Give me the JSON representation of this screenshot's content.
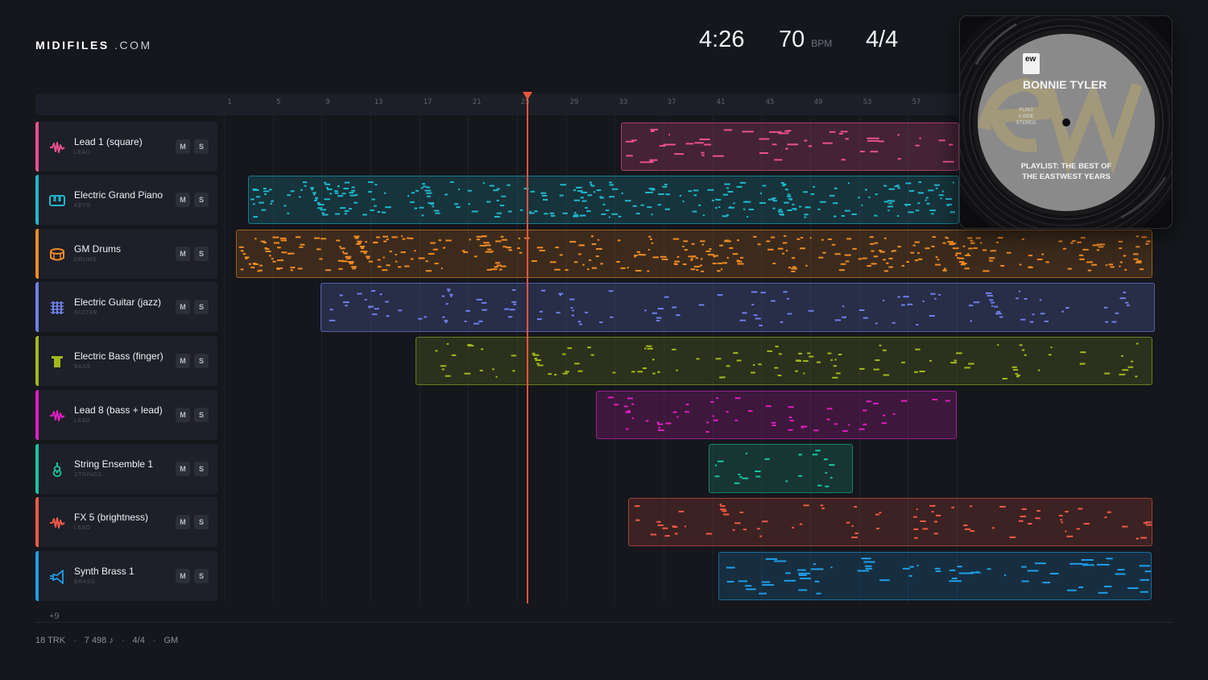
{
  "logo": {
    "brand": "MIDIFILES",
    "tld": ".COM"
  },
  "transport": {
    "time": "4:26",
    "tempo": "70",
    "tempo_unit": "BPM",
    "time_signature": "4/4"
  },
  "ruler": {
    "bars": [
      "1",
      "5",
      "9",
      "13",
      "17",
      "21",
      "25",
      "29",
      "33",
      "37",
      "41",
      "45",
      "49",
      "53",
      "57"
    ]
  },
  "playhead": {
    "bar": 25
  },
  "tracks": [
    {
      "name": "Lead 1 (square)",
      "category": "LEAD",
      "color": "#e8508f",
      "icon": "wave-icon",
      "mute": "M",
      "solo": "S"
    },
    {
      "name": "Electric Grand Piano",
      "category": "KEYS",
      "color": "#1fb7cc",
      "icon": "piano-icon",
      "mute": "M",
      "solo": "S"
    },
    {
      "name": "GM Drums",
      "category": "DRUMS",
      "color": "#f08a24",
      "icon": "drum-icon",
      "mute": "M",
      "solo": "S"
    },
    {
      "name": "Electric Guitar (jazz)",
      "category": "GUITAR",
      "color": "#6e7ee8",
      "icon": "guitar-icon",
      "mute": "M",
      "solo": "S"
    },
    {
      "name": "Electric Bass (finger)",
      "category": "BASS",
      "color": "#a3b81c",
      "icon": "bass-icon",
      "mute": "M",
      "solo": "S"
    },
    {
      "name": "Lead 8 (bass + lead)",
      "category": "LEAD",
      "color": "#e01ec0",
      "icon": "wave-icon",
      "mute": "M",
      "solo": "S"
    },
    {
      "name": "String Ensemble 1",
      "category": "STRINGS",
      "color": "#19c4a0",
      "icon": "strings-icon",
      "mute": "M",
      "solo": "S"
    },
    {
      "name": "FX 5 (brightness)",
      "category": "LEAD",
      "color": "#ee5a45",
      "icon": "wave-icon",
      "mute": "M",
      "solo": "S"
    },
    {
      "name": "Synth Brass 1",
      "category": "BRASS",
      "color": "#1f9de8",
      "icon": "brass-icon",
      "mute": "M",
      "solo": "S"
    }
  ],
  "more_tracks": "+9",
  "footer": {
    "tracks": "18 TRK",
    "notes": "7 498 ♪",
    "time_signature": "4/4",
    "standard": "GM"
  },
  "album": {
    "artist": "BONNIE TYLER",
    "title_line1": "PLAYLIST: THE BEST OF",
    "title_line2": "THE EASTWEST YEARS",
    "catalog_line1": "PL010",
    "catalog_line2": "A SIDE",
    "catalog_line3": "STEREO",
    "logo_text": "ew"
  }
}
